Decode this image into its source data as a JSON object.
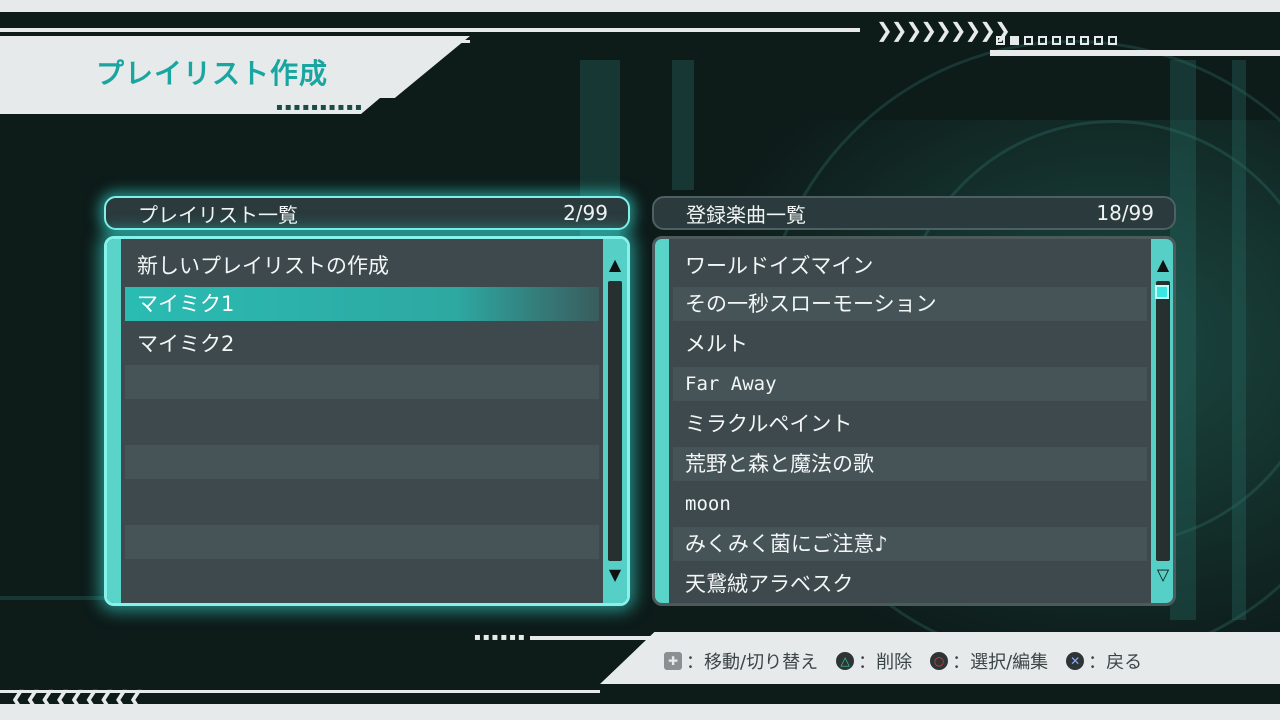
{
  "header": {
    "title": "プレイリスト作成",
    "deco_arrows": "❯❯❯❯❯❯❯❯❯",
    "page_indicator": [
      false,
      true,
      false,
      false,
      false,
      false,
      false,
      false,
      false
    ]
  },
  "playlist_panel": {
    "title": "プレイリスト一覧",
    "count": "2/99",
    "items": [
      "新しいプレイリストの作成",
      "マイミク1",
      "マイミク2",
      "",
      "",
      "",
      "",
      "",
      ""
    ],
    "selected_index": 1,
    "scroll_up": "▲",
    "scroll_down": "▼"
  },
  "songs_panel": {
    "title": "登録楽曲一覧",
    "count": "18/99",
    "items": [
      "ワールドイズマイン",
      "その一秒スローモーション",
      "メルト",
      "Far Away",
      "ミラクルペイント",
      "荒野と森と魔法の歌",
      "moon",
      "みくみく菌にご注意♪",
      "天鵞絨アラベスク"
    ],
    "scroll_up": "▲",
    "scroll_down": "▽"
  },
  "footer": {
    "hints": [
      {
        "icon": "dpad-icon",
        "glyph": "✚",
        "label": "：移動/切り替え"
      },
      {
        "icon": "triangle-button-icon",
        "glyph": "△",
        "label": "：削除"
      },
      {
        "icon": "circle-button-icon",
        "glyph": "○",
        "label": "：選択/編集"
      },
      {
        "icon": "cross-button-icon",
        "glyph": "✕",
        "label": "：戻る"
      }
    ],
    "left_arrows": "❮❮❮❮❮❮❮❮❮"
  },
  "colors": {
    "accent": "#1aa6a0",
    "panel_glow": "#86f2ec",
    "panel_bg": "#3d494c",
    "header_plate": "#e6eaea"
  }
}
